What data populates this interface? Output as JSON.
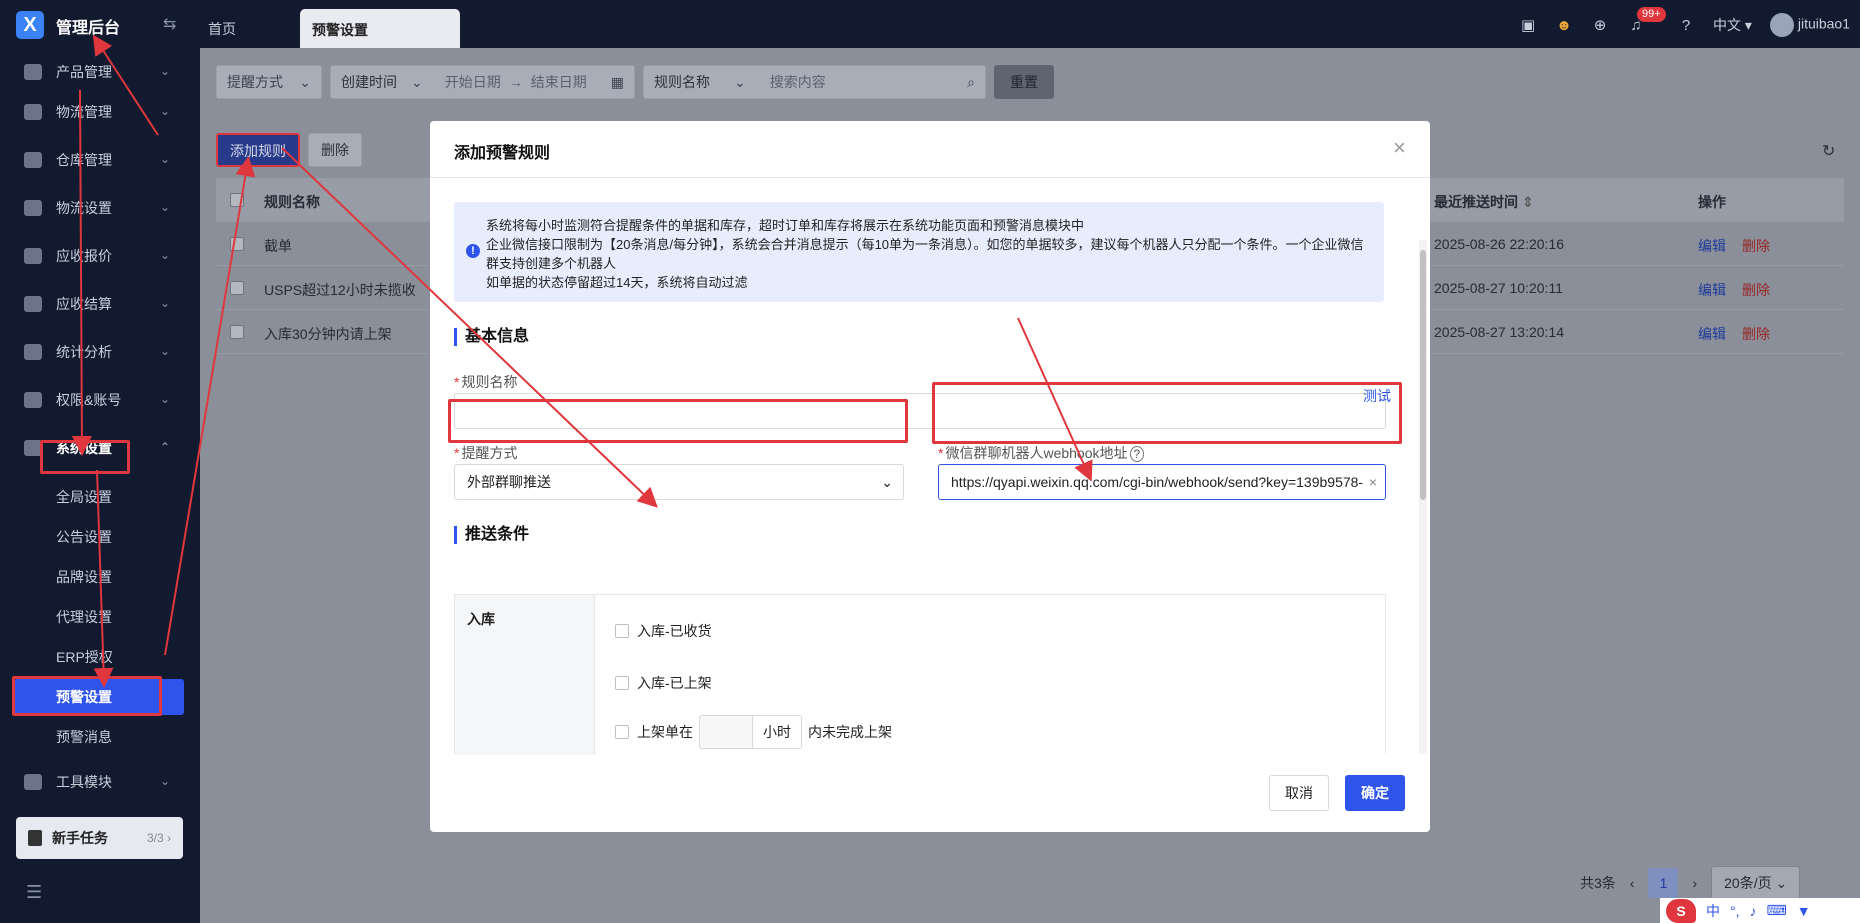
{
  "topbar": {
    "brand": "管理后台",
    "logo_letter": "X",
    "tabs": [
      {
        "label": "首页"
      },
      {
        "label": "预警设置"
      }
    ],
    "notification_badge": "99+",
    "language": "中文",
    "username": "jituibao1"
  },
  "sidebar": {
    "items": [
      {
        "label": "产品管理",
        "icon": "box-icon"
      },
      {
        "label": "物流管理",
        "icon": "truck-icon"
      },
      {
        "label": "仓库管理",
        "icon": "warehouse-icon"
      },
      {
        "label": "物流设置",
        "icon": "package-icon"
      },
      {
        "label": "应收报价",
        "icon": "document-icon"
      },
      {
        "label": "应收结算",
        "icon": "coin-icon"
      },
      {
        "label": "统计分析",
        "icon": "chart-icon"
      },
      {
        "label": "权限&账号",
        "icon": "org-icon"
      },
      {
        "label": "系统设置",
        "icon": "gear-icon"
      }
    ],
    "sub_items": [
      {
        "label": "全局设置"
      },
      {
        "label": "公告设置"
      },
      {
        "label": "品牌设置"
      },
      {
        "label": "代理设置"
      },
      {
        "label": "ERP授权"
      },
      {
        "label": "预警设置"
      },
      {
        "label": "预警消息"
      }
    ],
    "tools": {
      "label": "工具模块",
      "icon": "wrench-icon"
    },
    "newbie": {
      "label": "新手任务",
      "count": "3/3"
    }
  },
  "filters": {
    "remind_method": "提醒方式",
    "create_time": "创建时间",
    "start_date": "开始日期",
    "end_date": "结束日期",
    "arrow": "→",
    "rule_name": "规则名称",
    "search_placeholder": "搜索内容",
    "reset": "重置"
  },
  "toolbar": {
    "add_rule": "添加规则",
    "delete": "删除"
  },
  "table": {
    "columns": [
      "规则名称",
      "最近推送时间",
      "操作"
    ],
    "sort_glyph": "⇕",
    "rows": [
      {
        "name": "截单",
        "time": "2025-08-26 22:20:16"
      },
      {
        "name": "USPS超过12小时未揽收",
        "time": "2025-08-27 10:20:11"
      },
      {
        "name": "入库30分钟内请上架",
        "time": "2025-08-27 13:20:14"
      }
    ],
    "edit": "编辑",
    "delete": "删除"
  },
  "pager": {
    "total": "共3条",
    "current": "1",
    "page_size": "20条/页",
    "prev": "‹",
    "next": "›"
  },
  "modal": {
    "title": "添加预警规则",
    "alert": {
      "line1": "系统将每小时监测符合提醒条件的单据和库存，超时订单和库存将展示在系统功能页面和预警消息模块中",
      "line2": "企业微信接口限制为【20条消息/每分钟】，系统会合并消息提示（每10单为一条消息）。如您的单据较多，建议每个机器人只分配一个条件。一个企业微信群支持创建多个机器人",
      "line3": "如单据的状态停留超过14天，系统将自动过滤"
    },
    "section_basic": "基本信息",
    "rule_name_label": "规则名称",
    "rule_name_value": "",
    "remind_label": "提醒方式",
    "remind_value": "外部群聊推送",
    "webhook_label": "微信群聊机器人webhook地址",
    "webhook_value": "https://qyapi.weixin.qq.com/cgi-bin/webhook/send?key=139b9578-",
    "test": "测试",
    "section_push": "推送条件",
    "cond_group": "入库",
    "conditions": {
      "c1": "入库-已收货",
      "c2": "入库-已上架",
      "c3_prefix": "上架单在",
      "c3_unit": "小时",
      "c3_suffix": "内未完成上架"
    },
    "cancel": "取消",
    "ok": "确定",
    "close_glyph": "×",
    "required_mark": "*",
    "help_glyph": "?",
    "clear_glyph": "×"
  },
  "ime": {
    "lang": "中",
    "punct": "°,"
  },
  "colors": {
    "accent": "#2f54eb",
    "annotation": "#e0363d",
    "sidebar": "#111a2e"
  }
}
